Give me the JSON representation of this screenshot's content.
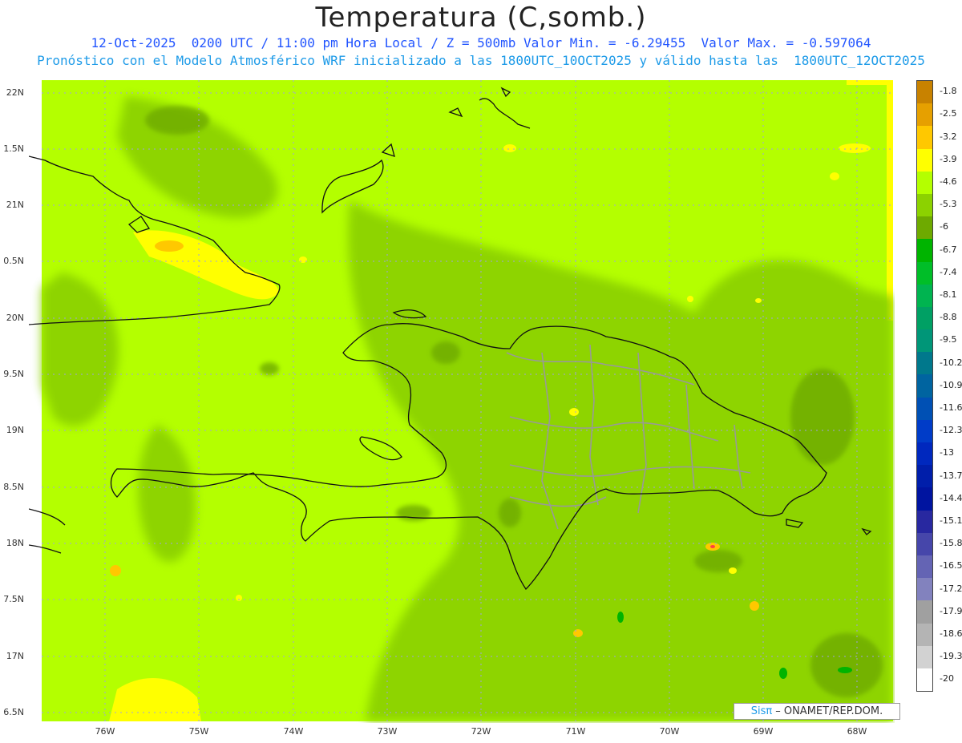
{
  "title": "Temperatura (C,somb.)",
  "subtitle_line1": "12-Oct-2025  0200 UTC / 11:00 pm Hora Local / Z = 500mb Valor Min. = -6.29455  Valor Max. = -0.597064",
  "subtitle_line2": "Pronóstico con el Modelo Atmosférico WRF inicializado a las 1800UTC_10OCT2025 y válido hasta las  1800UTC_12OCT2025",
  "lat_labels": [
    "22N",
    "1.5N",
    "21N",
    "0.5N",
    "20N",
    "9.5N",
    "19N",
    "8.5N",
    "18N",
    "7.5N",
    "17N",
    "6.5N"
  ],
  "lon_labels": [
    "76W",
    "75W",
    "74W",
    "73W",
    "72W",
    "71W",
    "70W",
    "69W",
    "68W"
  ],
  "colorbar": {
    "labels": [
      "-1.8",
      "-2.5",
      "-3.2",
      "-3.9",
      "-4.6",
      "-5.3",
      "-6",
      "-6.7",
      "-7.4",
      "-8.1",
      "-8.8",
      "-9.5",
      "-10.2",
      "-10.9",
      "-11.6",
      "-12.3",
      "-13",
      "-13.7",
      "-14.4",
      "-15.1",
      "-15.8",
      "-16.5",
      "-17.2",
      "-17.9",
      "-18.6",
      "-19.3",
      "-20"
    ],
    "colors": [
      "#c88200",
      "#e6a000",
      "#ffc800",
      "#ffff00",
      "#b4ff00",
      "#8cd200",
      "#6eaa00",
      "#00b400",
      "#00be28",
      "#00b450",
      "#00a064",
      "#009678",
      "#00788c",
      "#0064a0",
      "#0050b4",
      "#003cc8",
      "#0028be",
      "#001eaa",
      "#0014a0",
      "#2828a0",
      "#4646aa",
      "#6464b4",
      "#8282be",
      "#a0a0a0",
      "#b4b4b4",
      "#d2d2d2",
      "#ffffff"
    ]
  },
  "credit": {
    "sis": "Sisπ",
    "rest": "– ONAMET/REP.DOM."
  }
}
